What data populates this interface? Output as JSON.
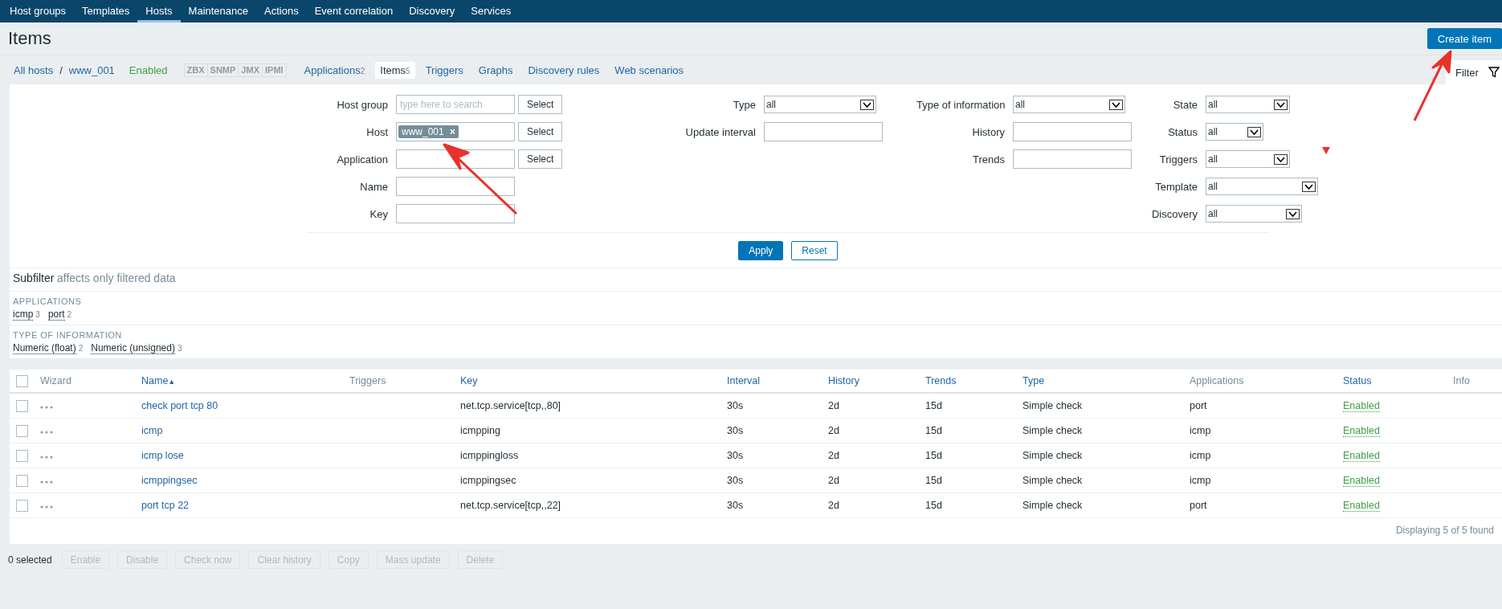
{
  "top_menu": [
    {
      "label": "Host groups",
      "selected": false
    },
    {
      "label": "Templates",
      "selected": false
    },
    {
      "label": "Hosts",
      "selected": true
    },
    {
      "label": "Maintenance",
      "selected": false
    },
    {
      "label": "Actions",
      "selected": false
    },
    {
      "label": "Event correlation",
      "selected": false
    },
    {
      "label": "Discovery",
      "selected": false
    },
    {
      "label": "Services",
      "selected": false
    }
  ],
  "title": "Items",
  "create_button": "Create item",
  "breadcrumb": [
    "All hosts",
    "/",
    "www_001"
  ],
  "host_status": "Enabled",
  "availability": [
    {
      "label": "ZBX",
      "on": false
    },
    {
      "label": "SNMP",
      "on": false
    },
    {
      "label": "JMX",
      "on": false
    },
    {
      "label": "IPMI",
      "on": false
    }
  ],
  "host_tabs": [
    {
      "label": "Applications",
      "count": "2",
      "selected": false
    },
    {
      "label": "Items",
      "count": "5",
      "selected": true
    },
    {
      "label": "Triggers",
      "selected": false
    },
    {
      "label": "Graphs",
      "selected": false
    },
    {
      "label": "Discovery rules",
      "selected": false
    },
    {
      "label": "Web scenarios",
      "selected": false
    }
  ],
  "filter_tab": "Filter",
  "filter_columns": [
    [
      {
        "label": "Host group",
        "kind": "multiselect",
        "placeholder": "type here to search",
        "button": "Select"
      },
      {
        "label": "Host",
        "kind": "multiselect",
        "chip": "www_001",
        "chip_remove": "×",
        "button": "Select"
      },
      {
        "label": "Application",
        "kind": "multiselect",
        "button": "Select"
      },
      {
        "label": "Name",
        "kind": "text"
      },
      {
        "label": "Key",
        "kind": "text"
      }
    ],
    [
      {
        "label": "Type",
        "kind": "dropdown",
        "value": "all"
      },
      {
        "label": "Update interval",
        "kind": "text"
      }
    ],
    [
      {
        "label": "Type of information",
        "kind": "dropdown",
        "value": "all"
      },
      {
        "label": "History",
        "kind": "text"
      },
      {
        "label": "Trends",
        "kind": "text"
      }
    ],
    [
      {
        "label": "State",
        "kind": "dropdown",
        "value": "all"
      },
      {
        "label": "Status",
        "kind": "dropdown",
        "value": "all"
      },
      {
        "label": "Triggers",
        "kind": "dropdown",
        "value": "all"
      },
      {
        "label": "Template",
        "kind": "dropdown",
        "value": "all"
      },
      {
        "label": "Discovery",
        "kind": "dropdown",
        "value": "all"
      }
    ]
  ],
  "filter_buttons": [
    {
      "label": "Apply",
      "primary": true
    },
    {
      "label": "Reset",
      "primary": false
    }
  ],
  "subfilter": {
    "title": "Subfilter",
    "note": "affects only filtered data",
    "groups": [
      {
        "heading": "APPLICATIONS",
        "items": [
          {
            "label": "icmp",
            "count": "3"
          },
          {
            "label": "port",
            "count": "2"
          }
        ]
      },
      {
        "heading": "TYPE OF INFORMATION",
        "items": [
          {
            "label": "Numeric (float)",
            "count": "2"
          },
          {
            "label": "Numeric (unsigned)",
            "count": "3"
          }
        ]
      }
    ]
  },
  "table": {
    "select_all_checked": false,
    "columns": [
      {
        "label": "Wizard",
        "link": false
      },
      {
        "label": "Name",
        "link": true,
        "sort_mark": "▲"
      },
      {
        "label": "Triggers",
        "link": false
      },
      {
        "label": "Key",
        "link": true
      },
      {
        "label": "Interval",
        "link": true
      },
      {
        "label": "History",
        "link": true
      },
      {
        "label": "Trends",
        "link": true
      },
      {
        "label": "Type",
        "link": true
      },
      {
        "label": "Applications",
        "link": false
      },
      {
        "label": "Status",
        "link": true
      },
      {
        "label": "Info",
        "link": false
      }
    ],
    "rows": [
      {
        "checked": false,
        "name": "check port tcp 80",
        "key": "net.tcp.service[tcp,,80]",
        "interval": "30s",
        "history": "2d",
        "trends": "15d",
        "type": "Simple check",
        "applications": "port",
        "status": "Enabled"
      },
      {
        "checked": false,
        "name": "icmp",
        "key": "icmpping",
        "interval": "30s",
        "history": "2d",
        "trends": "15d",
        "type": "Simple check",
        "applications": "icmp",
        "status": "Enabled"
      },
      {
        "checked": false,
        "name": "icmp lose",
        "key": "icmppingloss",
        "interval": "30s",
        "history": "2d",
        "trends": "15d",
        "type": "Simple check",
        "applications": "icmp",
        "status": "Enabled"
      },
      {
        "checked": false,
        "name": "icmppingsec",
        "key": "icmppingsec",
        "interval": "30s",
        "history": "2d",
        "trends": "15d",
        "type": "Simple check",
        "applications": "icmp",
        "status": "Enabled"
      },
      {
        "checked": false,
        "name": "port tcp 22",
        "key": "net.tcp.service[tcp,,22]",
        "interval": "30s",
        "history": "2d",
        "trends": "15d",
        "type": "Simple check",
        "applications": "port",
        "status": "Enabled"
      }
    ],
    "footer": "Displaying 5 of 5 found"
  },
  "selected_count": "0 selected",
  "mass_actions": [
    {
      "label": "Enable",
      "disabled": true
    },
    {
      "label": "Disable",
      "disabled": true
    },
    {
      "label": "Check now",
      "disabled": true
    },
    {
      "label": "Clear history",
      "disabled": true
    },
    {
      "label": "Copy",
      "disabled": true
    },
    {
      "label": "Mass update",
      "disabled": true
    },
    {
      "label": "Delete",
      "disabled": true
    }
  ]
}
